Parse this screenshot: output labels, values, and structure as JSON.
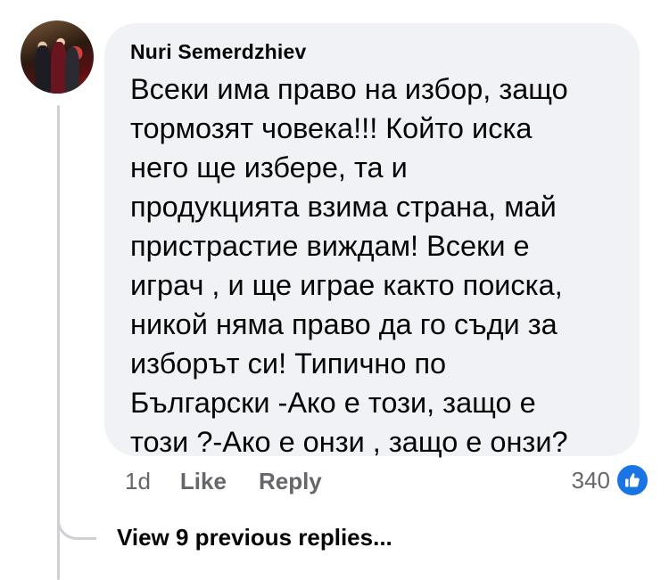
{
  "comment": {
    "author": "Nuri Semerdzhiev",
    "text_lines": [
      "Всеки има право на избор, защо",
      "тормозят човека!!! Който иска",
      "него ще избере, та и",
      "продукцията взима страна, май",
      "пристрастие виждам! Всеки е",
      "играч , и ще играе както поиска,",
      "никой няма право да го съди за",
      "изборът си! Типично по",
      "Български -Ако е този, защо е",
      "този ?-Ако е онзи , защо е онзи?"
    ],
    "timestamp": "1d",
    "like_label": "Like",
    "reply_label": "Reply",
    "reaction_count": "340",
    "reaction_icon": "thumbs-up-icon"
  },
  "thread": {
    "view_previous_replies": "View 9 previous replies..."
  },
  "colors": {
    "bubble": "#f0f2f5",
    "text": "#050505",
    "secondary_text": "#65676b",
    "like_blue": "#1b74e4",
    "thread_line": "#ced0d4"
  }
}
